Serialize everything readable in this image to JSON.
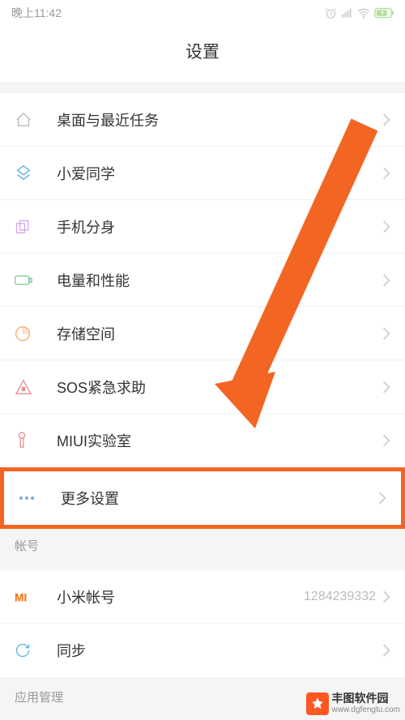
{
  "statusBar": {
    "time": "晚上11:42"
  },
  "header": {
    "title": "设置"
  },
  "items": {
    "desktop": "桌面与最近任务",
    "xiaoai": "小爱同学",
    "phoneClone": "手机分身",
    "battery": "电量和性能",
    "storage": "存储空间",
    "sos": "SOS紧急求助",
    "miuiLab": "MIUI实验室",
    "more": "更多设置",
    "miAccount": "小米帐号",
    "miAccountValue": "1284239332",
    "sync": "同步"
  },
  "sections": {
    "account": "帐号",
    "appManage": "应用管理"
  },
  "watermark": {
    "name": "丰图软件园",
    "url": "www.dgfengtu.com"
  }
}
